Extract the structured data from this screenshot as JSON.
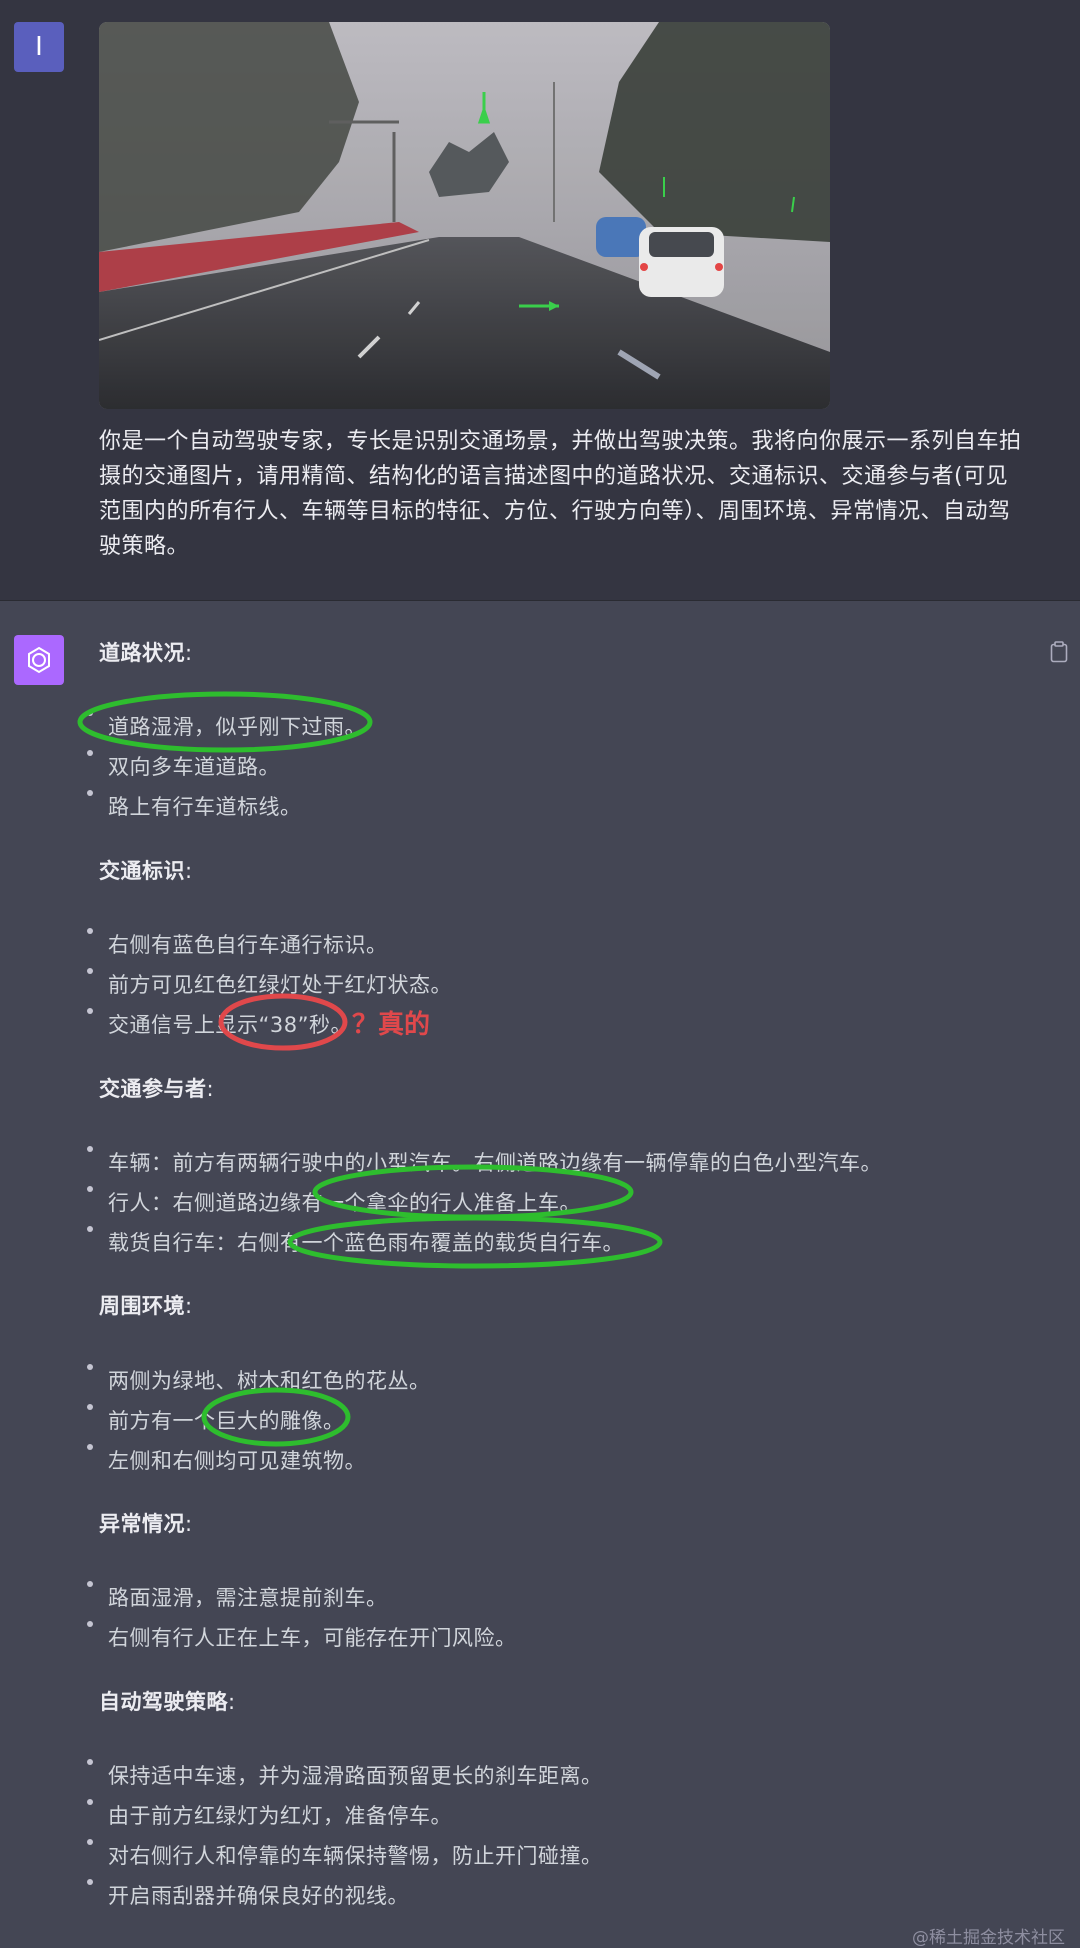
{
  "user": {
    "avatar_letter": "I",
    "prompt": "你是一个自动驾驶专家，专长是识别交通场景，并做出驾驶决策。我将向你展示一系列自车拍摄的交通图片，请用精简、结构化的语言描述图中的道路状况、交通标识、交通参与者(可见范围内的所有行人、车辆等目标的特征、方位、行驶方向等）、周围环境、异常情况、自动驾驶策略。"
  },
  "assistant": {
    "sections": [
      {
        "heading": "道路状况",
        "items": [
          "道路湿滑，似乎刚下过雨。",
          "双向多车道道路。",
          "路上有行车道标线。"
        ]
      },
      {
        "heading": "交通标识",
        "items": [
          "右侧有蓝色自行车通行标识。",
          "前方可见红色红绿灯处于红灯状态。",
          "交通信号上显示“38”秒。"
        ]
      },
      {
        "heading": "交通参与者",
        "items": [
          "车辆：前方有两辆行驶中的小型汽车。右侧道路边缘有一辆停靠的白色小型汽车。",
          "行人：右侧道路边缘有一个拿伞的行人准备上车。",
          "载货自行车：右侧有一个蓝色雨布覆盖的载货自行车。"
        ]
      },
      {
        "heading": "周围环境",
        "items": [
          "两侧为绿地、树木和红色的花丛。",
          "前方有一个巨大的雕像。",
          "左侧和右侧均可见建筑物。"
        ]
      },
      {
        "heading": "异常情况",
        "items": [
          "路面湿滑，需注意提前刹车。",
          "右侧有行人正在上车，可能存在开门风险。"
        ]
      },
      {
        "heading": "自动驾驶策略",
        "items": [
          "保持适中车速，并为湿滑路面预留更长的刹车距离。",
          "由于前方红绿灯为红灯，准备停车。",
          "对右侧行人和停靠的车辆保持警惕，防止开门碰撞。",
          "开启雨刮器并确保良好的视线。"
        ]
      }
    ],
    "colon": ":",
    "annotation_note": "？真的"
  },
  "watermark": "@稀土掘金技术社区",
  "colors": {
    "user_bg": "#343541",
    "assistant_bg": "#444654",
    "user_avatar": "#5a5fbd",
    "bot_avatar": "#ab68ff",
    "green_annotation": "#2ebd2e",
    "red_annotation": "#e0484b"
  },
  "icons": {
    "bot_avatar": "openai-logo-icon",
    "copy": "clipboard-icon"
  }
}
